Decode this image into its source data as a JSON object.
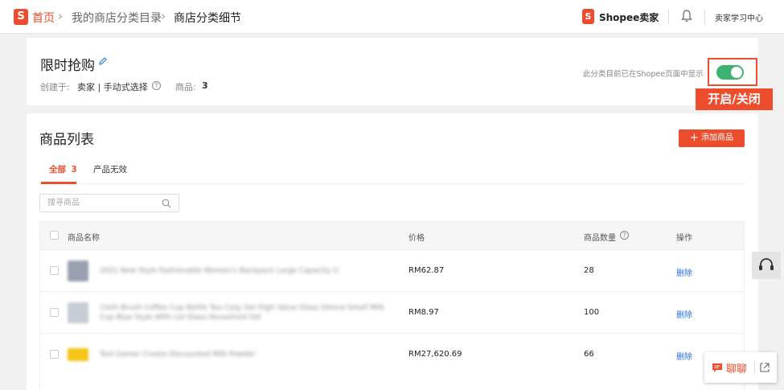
{
  "breadcrumb": {
    "home": "首页",
    "level1": "我的商店分类目录",
    "current": "商店分类细节"
  },
  "header": {
    "logo_letter": "S",
    "seller_center": "Shopee卖家",
    "learning_center": "卖家学习中心",
    "icons": [
      "shopee-logo-icon",
      "bell-icon"
    ]
  },
  "category": {
    "title": "限时抢购",
    "created_by_label": "创建于:",
    "created_by_value": "卖家 | 手动式选择",
    "products_label": "商品:",
    "products_count": "3",
    "toggle_hint": "此分类目前已在Shopee页面中显示",
    "toggle_on": true,
    "annotation": "开启/关闭"
  },
  "product_list": {
    "title": "商品列表",
    "add_button": "添加商品",
    "tabs": [
      {
        "label": "全部",
        "count": "3",
        "active": true
      },
      {
        "label": "产品无效",
        "active": false
      }
    ],
    "search_placeholder": "搜寻商品",
    "columns": [
      "商品名称",
      "价格",
      "商品数量",
      "操作"
    ],
    "rows": [
      {
        "name": "2021 New Style Fashionable Women's Backpack Large Capacity U",
        "price": "RM62.87",
        "quantity": "28",
        "action": "删除",
        "thumb_color": "#9aa0b0"
      },
      {
        "name": "Cloth Brush Coffee Cup Kettle Tea Cozy Set High Value Glass Sleeve Small Milk Cup Blue Style With Lid Glass Household Set",
        "price": "RM8.97",
        "quantity": "100",
        "action": "删除",
        "thumb_color": "#c8ccd6"
      },
      {
        "name": "Tool Gamer Create Discounted Milk Powder",
        "price": "RM27,620.69",
        "quantity": "66",
        "action": "删除",
        "thumb_color": "#f5c518"
      }
    ]
  },
  "chat": {
    "label": "聊聊"
  },
  "colors": {
    "brand": "#ee4d2d",
    "toggle_on": "#3cb371",
    "link": "#2673dd"
  }
}
